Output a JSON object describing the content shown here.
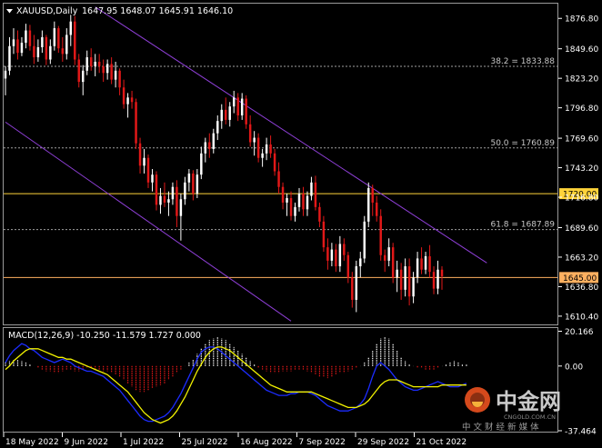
{
  "header": {
    "symbol": "XAUUSD,Daily",
    "ohlc": "1647.95 1648.07 1645.91 1646.10"
  },
  "chart_data": [
    {
      "type": "candlestick",
      "title": "XAUUSD,Daily",
      "ylim": [
        1603,
        1890
      ],
      "y_ticks": [
        "1876.80",
        "1849.60",
        "1823.20",
        "1796.80",
        "1769.60",
        "1743.20",
        "1716.80",
        "1689.60",
        "1663.20",
        "1636.80",
        "1610.40"
      ],
      "x_ticks": [
        "18 May 2022",
        "9 Jun 2022",
        "1 Jul 2022",
        "25 Jul 2022",
        "16 Aug 2022",
        "7 Sep 2022",
        "29 Sep 2022",
        "21 Oct 2022"
      ],
      "grid": false,
      "bars": [
        {
          "o": 1823,
          "h": 1834,
          "l": 1808,
          "c": 1830
        },
        {
          "o": 1830,
          "h": 1860,
          "l": 1826,
          "c": 1852
        },
        {
          "o": 1852,
          "h": 1868,
          "l": 1845,
          "c": 1858
        },
        {
          "o": 1858,
          "h": 1866,
          "l": 1840,
          "c": 1846
        },
        {
          "o": 1846,
          "h": 1860,
          "l": 1843,
          "c": 1855
        },
        {
          "o": 1855,
          "h": 1872,
          "l": 1850,
          "c": 1866
        },
        {
          "o": 1866,
          "h": 1871,
          "l": 1848,
          "c": 1852
        },
        {
          "o": 1852,
          "h": 1862,
          "l": 1836,
          "c": 1842
        },
        {
          "o": 1842,
          "h": 1858,
          "l": 1838,
          "c": 1851
        },
        {
          "o": 1851,
          "h": 1866,
          "l": 1846,
          "c": 1860
        },
        {
          "o": 1860,
          "h": 1862,
          "l": 1835,
          "c": 1840
        },
        {
          "o": 1840,
          "h": 1858,
          "l": 1836,
          "c": 1852
        },
        {
          "o": 1852,
          "h": 1874,
          "l": 1848,
          "c": 1868
        },
        {
          "o": 1868,
          "h": 1870,
          "l": 1846,
          "c": 1850
        },
        {
          "o": 1850,
          "h": 1860,
          "l": 1838,
          "c": 1845
        },
        {
          "o": 1845,
          "h": 1868,
          "l": 1840,
          "c": 1862
        },
        {
          "o": 1862,
          "h": 1880,
          "l": 1852,
          "c": 1874
        },
        {
          "o": 1874,
          "h": 1879,
          "l": 1835,
          "c": 1840
        },
        {
          "o": 1840,
          "h": 1845,
          "l": 1815,
          "c": 1820
        },
        {
          "o": 1820,
          "h": 1835,
          "l": 1808,
          "c": 1830
        },
        {
          "o": 1830,
          "h": 1848,
          "l": 1826,
          "c": 1842
        },
        {
          "o": 1842,
          "h": 1850,
          "l": 1830,
          "c": 1834
        },
        {
          "o": 1834,
          "h": 1845,
          "l": 1825,
          "c": 1838
        },
        {
          "o": 1838,
          "h": 1845,
          "l": 1828,
          "c": 1834
        },
        {
          "o": 1834,
          "h": 1840,
          "l": 1820,
          "c": 1828
        },
        {
          "o": 1828,
          "h": 1840,
          "l": 1822,
          "c": 1836
        },
        {
          "o": 1836,
          "h": 1842,
          "l": 1818,
          "c": 1822
        },
        {
          "o": 1822,
          "h": 1838,
          "l": 1815,
          "c": 1830
        },
        {
          "o": 1830,
          "h": 1832,
          "l": 1808,
          "c": 1815
        },
        {
          "o": 1815,
          "h": 1822,
          "l": 1796,
          "c": 1800
        },
        {
          "o": 1800,
          "h": 1810,
          "l": 1788,
          "c": 1806
        },
        {
          "o": 1806,
          "h": 1812,
          "l": 1796,
          "c": 1802
        },
        {
          "o": 1802,
          "h": 1805,
          "l": 1760,
          "c": 1765
        },
        {
          "o": 1765,
          "h": 1770,
          "l": 1738,
          "c": 1745
        },
        {
          "o": 1745,
          "h": 1760,
          "l": 1738,
          "c": 1752
        },
        {
          "o": 1752,
          "h": 1755,
          "l": 1725,
          "c": 1730
        },
        {
          "o": 1730,
          "h": 1742,
          "l": 1722,
          "c": 1737
        },
        {
          "o": 1737,
          "h": 1740,
          "l": 1705,
          "c": 1710
        },
        {
          "o": 1710,
          "h": 1725,
          "l": 1702,
          "c": 1718
        },
        {
          "o": 1718,
          "h": 1730,
          "l": 1708,
          "c": 1712
        },
        {
          "o": 1712,
          "h": 1722,
          "l": 1700,
          "c": 1715
        },
        {
          "o": 1715,
          "h": 1730,
          "l": 1710,
          "c": 1726
        },
        {
          "o": 1726,
          "h": 1732,
          "l": 1690,
          "c": 1700
        },
        {
          "o": 1700,
          "h": 1720,
          "l": 1678,
          "c": 1715
        },
        {
          "o": 1715,
          "h": 1735,
          "l": 1710,
          "c": 1730
        },
        {
          "o": 1730,
          "h": 1742,
          "l": 1722,
          "c": 1738
        },
        {
          "o": 1738,
          "h": 1741,
          "l": 1714,
          "c": 1720
        },
        {
          "o": 1720,
          "h": 1742,
          "l": 1716,
          "c": 1737
        },
        {
          "o": 1737,
          "h": 1762,
          "l": 1733,
          "c": 1756
        },
        {
          "o": 1756,
          "h": 1770,
          "l": 1748,
          "c": 1766
        },
        {
          "o": 1766,
          "h": 1774,
          "l": 1752,
          "c": 1760
        },
        {
          "o": 1760,
          "h": 1778,
          "l": 1756,
          "c": 1774
        },
        {
          "o": 1774,
          "h": 1790,
          "l": 1768,
          "c": 1785
        },
        {
          "o": 1785,
          "h": 1800,
          "l": 1778,
          "c": 1795
        },
        {
          "o": 1795,
          "h": 1806,
          "l": 1782,
          "c": 1786
        },
        {
          "o": 1786,
          "h": 1802,
          "l": 1780,
          "c": 1798
        },
        {
          "o": 1798,
          "h": 1812,
          "l": 1792,
          "c": 1806
        },
        {
          "o": 1806,
          "h": 1810,
          "l": 1785,
          "c": 1790
        },
        {
          "o": 1790,
          "h": 1810,
          "l": 1786,
          "c": 1805
        },
        {
          "o": 1805,
          "h": 1808,
          "l": 1778,
          "c": 1782
        },
        {
          "o": 1782,
          "h": 1790,
          "l": 1762,
          "c": 1766
        },
        {
          "o": 1766,
          "h": 1776,
          "l": 1754,
          "c": 1770
        },
        {
          "o": 1770,
          "h": 1774,
          "l": 1748,
          "c": 1752
        },
        {
          "o": 1752,
          "h": 1760,
          "l": 1744,
          "c": 1756
        },
        {
          "o": 1756,
          "h": 1770,
          "l": 1750,
          "c": 1764
        },
        {
          "o": 1764,
          "h": 1772,
          "l": 1752,
          "c": 1756
        },
        {
          "o": 1756,
          "h": 1760,
          "l": 1736,
          "c": 1740
        },
        {
          "o": 1740,
          "h": 1748,
          "l": 1720,
          "c": 1726
        },
        {
          "o": 1726,
          "h": 1730,
          "l": 1706,
          "c": 1712
        },
        {
          "o": 1712,
          "h": 1720,
          "l": 1700,
          "c": 1716
        },
        {
          "o": 1716,
          "h": 1722,
          "l": 1696,
          "c": 1700
        },
        {
          "o": 1700,
          "h": 1712,
          "l": 1695,
          "c": 1708
        },
        {
          "o": 1708,
          "h": 1725,
          "l": 1704,
          "c": 1720
        },
        {
          "o": 1720,
          "h": 1726,
          "l": 1700,
          "c": 1706
        },
        {
          "o": 1706,
          "h": 1722,
          "l": 1700,
          "c": 1718
        },
        {
          "o": 1718,
          "h": 1735,
          "l": 1714,
          "c": 1730
        },
        {
          "o": 1730,
          "h": 1736,
          "l": 1705,
          "c": 1708
        },
        {
          "o": 1708,
          "h": 1712,
          "l": 1690,
          "c": 1695
        },
        {
          "o": 1695,
          "h": 1700,
          "l": 1668,
          "c": 1672
        },
        {
          "o": 1672,
          "h": 1680,
          "l": 1652,
          "c": 1660
        },
        {
          "o": 1660,
          "h": 1676,
          "l": 1655,
          "c": 1670
        },
        {
          "o": 1670,
          "h": 1675,
          "l": 1650,
          "c": 1655
        },
        {
          "o": 1655,
          "h": 1682,
          "l": 1650,
          "c": 1675
        },
        {
          "o": 1675,
          "h": 1680,
          "l": 1660,
          "c": 1665
        },
        {
          "o": 1665,
          "h": 1668,
          "l": 1640,
          "c": 1645
        },
        {
          "o": 1645,
          "h": 1650,
          "l": 1618,
          "c": 1625
        },
        {
          "o": 1625,
          "h": 1660,
          "l": 1614,
          "c": 1655
        },
        {
          "o": 1655,
          "h": 1668,
          "l": 1645,
          "c": 1662
        },
        {
          "o": 1662,
          "h": 1700,
          "l": 1658,
          "c": 1695
        },
        {
          "o": 1695,
          "h": 1730,
          "l": 1690,
          "c": 1725
        },
        {
          "o": 1725,
          "h": 1728,
          "l": 1700,
          "c": 1712
        },
        {
          "o": 1712,
          "h": 1718,
          "l": 1695,
          "c": 1700
        },
        {
          "o": 1700,
          "h": 1706,
          "l": 1660,
          "c": 1665
        },
        {
          "o": 1665,
          "h": 1670,
          "l": 1650,
          "c": 1660
        },
        {
          "o": 1660,
          "h": 1680,
          "l": 1655,
          "c": 1672
        },
        {
          "o": 1672,
          "h": 1676,
          "l": 1640,
          "c": 1645
        },
        {
          "o": 1645,
          "h": 1660,
          "l": 1632,
          "c": 1652
        },
        {
          "o": 1652,
          "h": 1658,
          "l": 1625,
          "c": 1634
        },
        {
          "o": 1634,
          "h": 1662,
          "l": 1628,
          "c": 1655
        },
        {
          "o": 1655,
          "h": 1662,
          "l": 1620,
          "c": 1628
        },
        {
          "o": 1628,
          "h": 1650,
          "l": 1622,
          "c": 1645
        },
        {
          "o": 1645,
          "h": 1668,
          "l": 1640,
          "c": 1662
        },
        {
          "o": 1662,
          "h": 1672,
          "l": 1648,
          "c": 1652
        },
        {
          "o": 1652,
          "h": 1668,
          "l": 1648,
          "c": 1664
        },
        {
          "o": 1664,
          "h": 1674,
          "l": 1645,
          "c": 1650
        },
        {
          "o": 1650,
          "h": 1655,
          "l": 1630,
          "c": 1635
        },
        {
          "o": 1635,
          "h": 1660,
          "l": 1630,
          "c": 1652
        },
        {
          "o": 1652,
          "h": 1655,
          "l": 1634,
          "c": 1646
        }
      ],
      "levels": [
        {
          "label": "38.2 = 1833.88",
          "value": 1833.88,
          "style": "fib",
          "color": "#a0a0a0"
        },
        {
          "label": "50.0 = 1760.89",
          "value": 1760.89,
          "style": "fib",
          "color": "#a0a0a0"
        },
        {
          "label": "61.8 = 1687.89",
          "value": 1687.89,
          "style": "fib",
          "color": "#a0a0a0"
        },
        {
          "label": "1720.00",
          "value": 1720.0,
          "style": "hline",
          "color": "#ffd33a"
        },
        {
          "label": "1645.00",
          "value": 1645.0,
          "style": "hline",
          "color": "#ffb060"
        }
      ],
      "channel": {
        "color": "#8e3fd6",
        "upper": [
          {
            "bar": 22,
            "y": 1887
          },
          {
            "bar": 118,
            "y": 1658
          }
        ],
        "lower": [
          {
            "bar": 0,
            "y": 1784
          },
          {
            "bar": 70,
            "y": 1606
          }
        ]
      },
      "colors": {
        "up": "#ffffff",
        "down": "#e21818",
        "axis": "#ffffff"
      }
    },
    {
      "type": "macd",
      "title": "MACD(12,26,9) -10.250 -11.579 1.727 0.000",
      "ylim": [
        -38,
        22
      ],
      "y_ticks": [
        "20.166",
        "0.00",
        "-37.464"
      ],
      "histogram": [
        2,
        3,
        4,
        4,
        3,
        2,
        1,
        0,
        -1,
        -2,
        -3,
        -3,
        -4,
        -4,
        -3,
        -2,
        -2,
        -3,
        -3,
        -2,
        -1,
        -1,
        -2,
        -2,
        -3,
        -3,
        -4,
        -5,
        -6,
        -8,
        -10,
        -12,
        -14,
        -15,
        -15,
        -14,
        -13,
        -12,
        -11,
        -10,
        -8,
        -6,
        -4,
        -2,
        0,
        2,
        4,
        7,
        10,
        13,
        15,
        16,
        17,
        16,
        15,
        13,
        11,
        9,
        7,
        5,
        3,
        1,
        -1,
        -2,
        -3,
        -4,
        -4,
        -4,
        -3,
        -3,
        -3,
        -2,
        -2,
        -2,
        -3,
        -4,
        -5,
        -6,
        -6,
        -7,
        -6,
        -5,
        -4,
        -4,
        -3,
        -2,
        -1,
        0,
        2,
        5,
        9,
        13,
        16,
        17,
        16,
        13,
        9,
        5,
        3,
        1,
        0,
        -1,
        -1,
        -2,
        -2,
        -2,
        -1,
        0,
        1,
        2,
        3,
        2,
        1,
        1
      ],
      "macd_line": [
        2,
        6,
        9,
        11,
        13,
        12,
        10,
        9,
        7,
        5,
        4,
        3,
        2,
        3,
        4,
        3,
        2,
        0,
        -1,
        -2,
        -3,
        -3,
        -4,
        -5,
        -6,
        -8,
        -10,
        -12,
        -14,
        -17,
        -20,
        -23,
        -26,
        -29,
        -31,
        -32,
        -32,
        -31,
        -30,
        -29,
        -27,
        -24,
        -20,
        -16,
        -11,
        -6,
        -1,
        4,
        8,
        10,
        11,
        11,
        10,
        8,
        6,
        4,
        2,
        0,
        -2,
        -4,
        -6,
        -8,
        -10,
        -12,
        -14,
        -15,
        -16,
        -17,
        -17,
        -17,
        -16,
        -16,
        -15,
        -15,
        -15,
        -16,
        -17,
        -19,
        -21,
        -23,
        -24,
        -25,
        -26,
        -26,
        -26,
        -25,
        -24,
        -22,
        -19,
        -13,
        -6,
        0,
        2,
        0,
        -2,
        -5,
        -8,
        -10,
        -12,
        -13,
        -14,
        -14,
        -13,
        -12,
        -11,
        -10,
        -9,
        -10,
        -11,
        -12,
        -12,
        -12,
        -11,
        -10
      ],
      "signal_line": [
        -2,
        0,
        3,
        5,
        7,
        9,
        10,
        10,
        10,
        9,
        8,
        7,
        6,
        5,
        5,
        4,
        4,
        3,
        2,
        1,
        0,
        -1,
        -2,
        -3,
        -4,
        -5,
        -7,
        -9,
        -11,
        -13,
        -15,
        -18,
        -21,
        -24,
        -27,
        -29,
        -31,
        -32,
        -33,
        -32,
        -31,
        -29,
        -26,
        -22,
        -18,
        -13,
        -8,
        -3,
        1,
        5,
        8,
        10,
        11,
        11,
        10,
        9,
        7,
        5,
        3,
        1,
        -1,
        -3,
        -5,
        -7,
        -9,
        -11,
        -12,
        -13,
        -14,
        -15,
        -15,
        -15,
        -15,
        -15,
        -15,
        -15,
        -16,
        -17,
        -18,
        -19,
        -20,
        -21,
        -22,
        -23,
        -24,
        -24,
        -24,
        -23,
        -22,
        -20,
        -17,
        -14,
        -11,
        -9,
        -8,
        -8,
        -8,
        -9,
        -10,
        -11,
        -12,
        -12,
        -12,
        -12,
        -12,
        -12,
        -12,
        -11,
        -11,
        -11,
        -11,
        -11,
        -11,
        -11
      ],
      "colors": {
        "hist_pos": "#ffffff",
        "hist_neg": "#e21818",
        "macd": "#1c2cff",
        "signal": "#f2f200"
      }
    }
  ],
  "watermark": {
    "brand_cn": "中金网",
    "domain": "CNGOLD.COM.CN",
    "slogan_cn": "中 文 财 经 新 媒 体"
  }
}
